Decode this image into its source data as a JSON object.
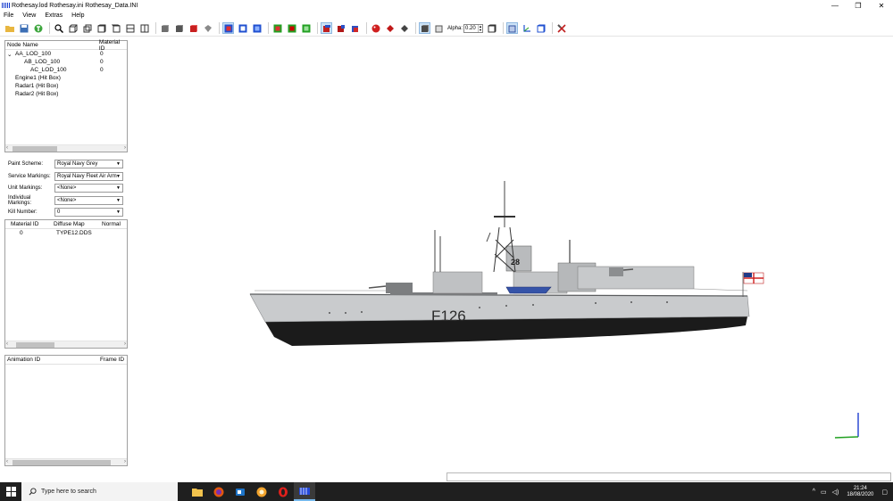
{
  "window": {
    "title": "Rothesay.lod  Rothesay.ini  Rothesay_Data.INI",
    "minimize": "—",
    "restore": "❐",
    "close": "✕"
  },
  "menu": [
    "File",
    "View",
    "Extras",
    "Help"
  ],
  "toolbar": {
    "alpha_label": "Alpha:",
    "alpha_value": "0.20"
  },
  "node_tree": {
    "columns": [
      "Node Name",
      "Material ID"
    ],
    "rows": [
      {
        "name": "AA_LOD_100",
        "material_id": "0",
        "indent": 1,
        "expander": "⌄"
      },
      {
        "name": "AB_LOD_100",
        "material_id": "0",
        "indent": 2,
        "expander": ""
      },
      {
        "name": "AC_LOD_100",
        "material_id": "0",
        "indent": 3,
        "expander": ""
      },
      {
        "name": "Engine1 (Hit Box)",
        "material_id": "",
        "indent": 1,
        "expander": ""
      },
      {
        "name": "Radar1 (Hit Box)",
        "material_id": "",
        "indent": 1,
        "expander": ""
      },
      {
        "name": "Radar2 (Hit Box)",
        "material_id": "",
        "indent": 1,
        "expander": ""
      }
    ]
  },
  "properties": {
    "paint_scheme": {
      "label": "Paint Scheme:",
      "value": "Royal Navy Grey"
    },
    "service_markings": {
      "label": "Service Markings:",
      "value": "Royal Navy Fleet Air Arm"
    },
    "unit_markings": {
      "label": "Unit Markings:",
      "value": "<None>"
    },
    "individual_markings": {
      "label": "Individual Markings:",
      "value": "<None>"
    },
    "kill_number": {
      "label": "Kill Number:",
      "value": "0"
    }
  },
  "materials": {
    "columns": [
      "Material ID",
      "Diffuse Map",
      "Normal"
    ],
    "rows": [
      {
        "material_id": "0",
        "diffuse_map": "TYPE12.DDS",
        "normal": ""
      }
    ]
  },
  "animations": {
    "columns": [
      "Animation ID",
      "Frame ID"
    ]
  },
  "model": {
    "pennant_number": "F126",
    "bridge_number": "28",
    "hull_color": "#c9cbcd",
    "boot_color": "#1b1b1b"
  },
  "taskbar": {
    "search_placeholder": "Type here to search",
    "time": "21:24",
    "date": "18/08/2020"
  }
}
